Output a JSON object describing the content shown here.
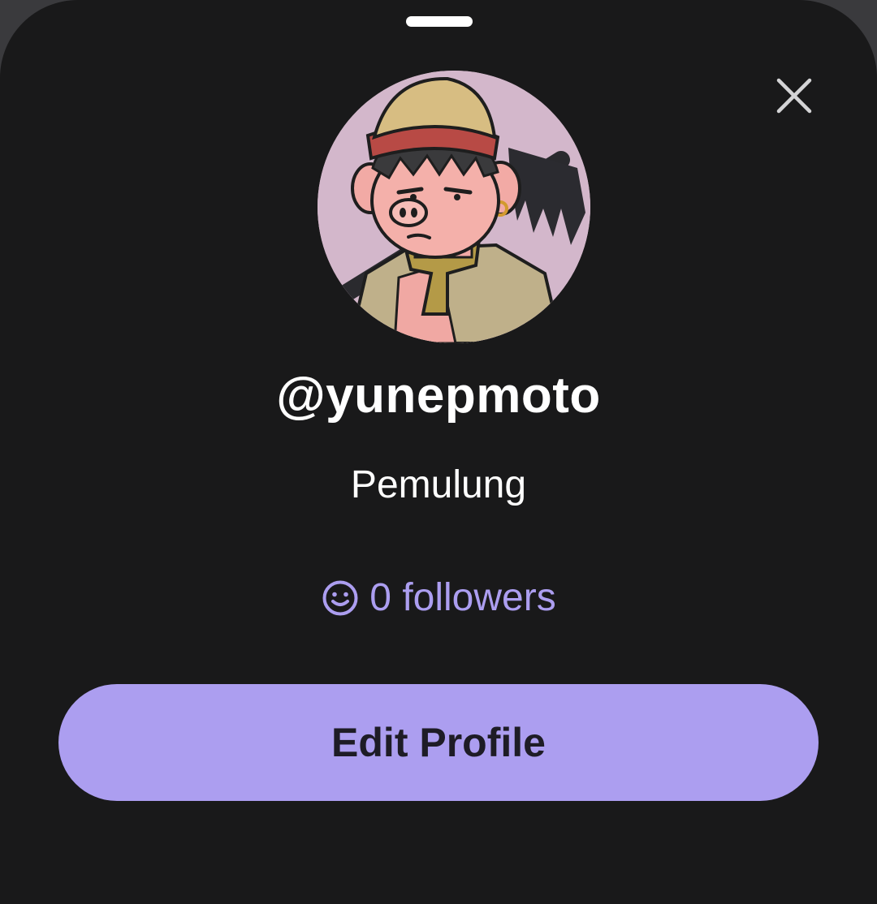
{
  "profile": {
    "username": "@yunepmoto",
    "bio": "Pemulung",
    "followers_label": "0 followers",
    "followers_count": 0,
    "avatar_alt": "Cartoon pig character wearing a beanie and headband holding a rake"
  },
  "actions": {
    "edit_profile_label": "Edit Profile"
  },
  "icons": {
    "close": "close-icon",
    "followers": "smiley-icon"
  },
  "colors": {
    "background": "#19191a",
    "accent": "#ac9ef0",
    "text_primary": "#ffffff",
    "button_text": "#1e1c26"
  }
}
